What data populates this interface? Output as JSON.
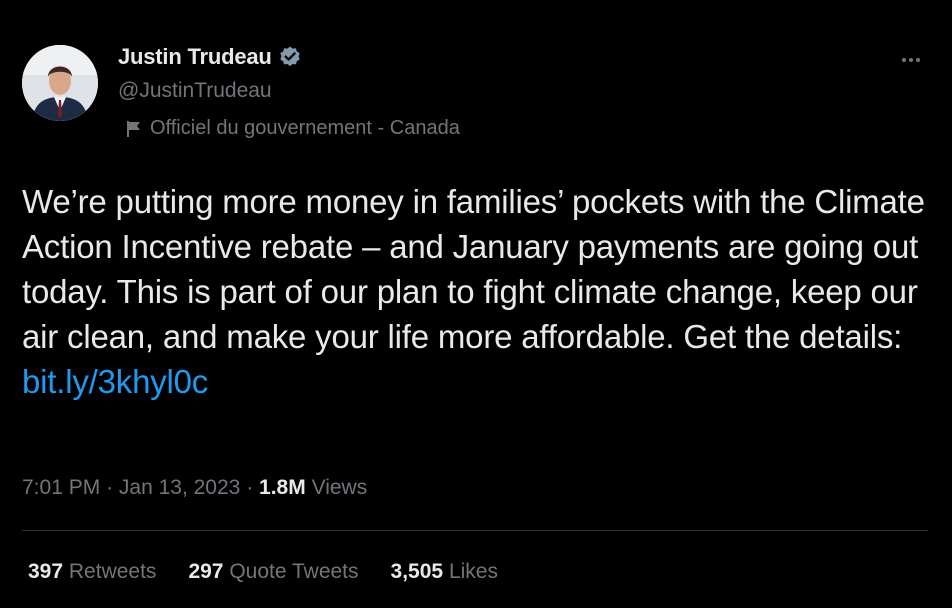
{
  "author": {
    "display_name": "Justin Trudeau",
    "handle": "@JustinTrudeau",
    "label": "Officiel du gouvernement - Canada",
    "verified_color": "#829aab"
  },
  "tweet": {
    "text": "We’re putting more money in families’ pockets with the Climate Action Incentive rebate – and January payments are going out today. This is part of our plan to fight climate change, keep our air clean, and make your life more affordable. Get the details:",
    "link": "bit.ly/3khyl0c",
    "link_color": "#1d9bf0"
  },
  "meta": {
    "time": "7:01 PM",
    "sep1": "·",
    "date": "Jan 13, 2023",
    "sep2": "·",
    "views_count": "1.8M",
    "views_label": "Views"
  },
  "stats": [
    {
      "count": "397",
      "label": "Retweets"
    },
    {
      "count": "297",
      "label": "Quote Tweets"
    },
    {
      "count": "3,505",
      "label": "Likes"
    }
  ],
  "icons": {
    "more": "more-icon",
    "verified": "verified-badge-icon",
    "flag": "flag-icon"
  }
}
